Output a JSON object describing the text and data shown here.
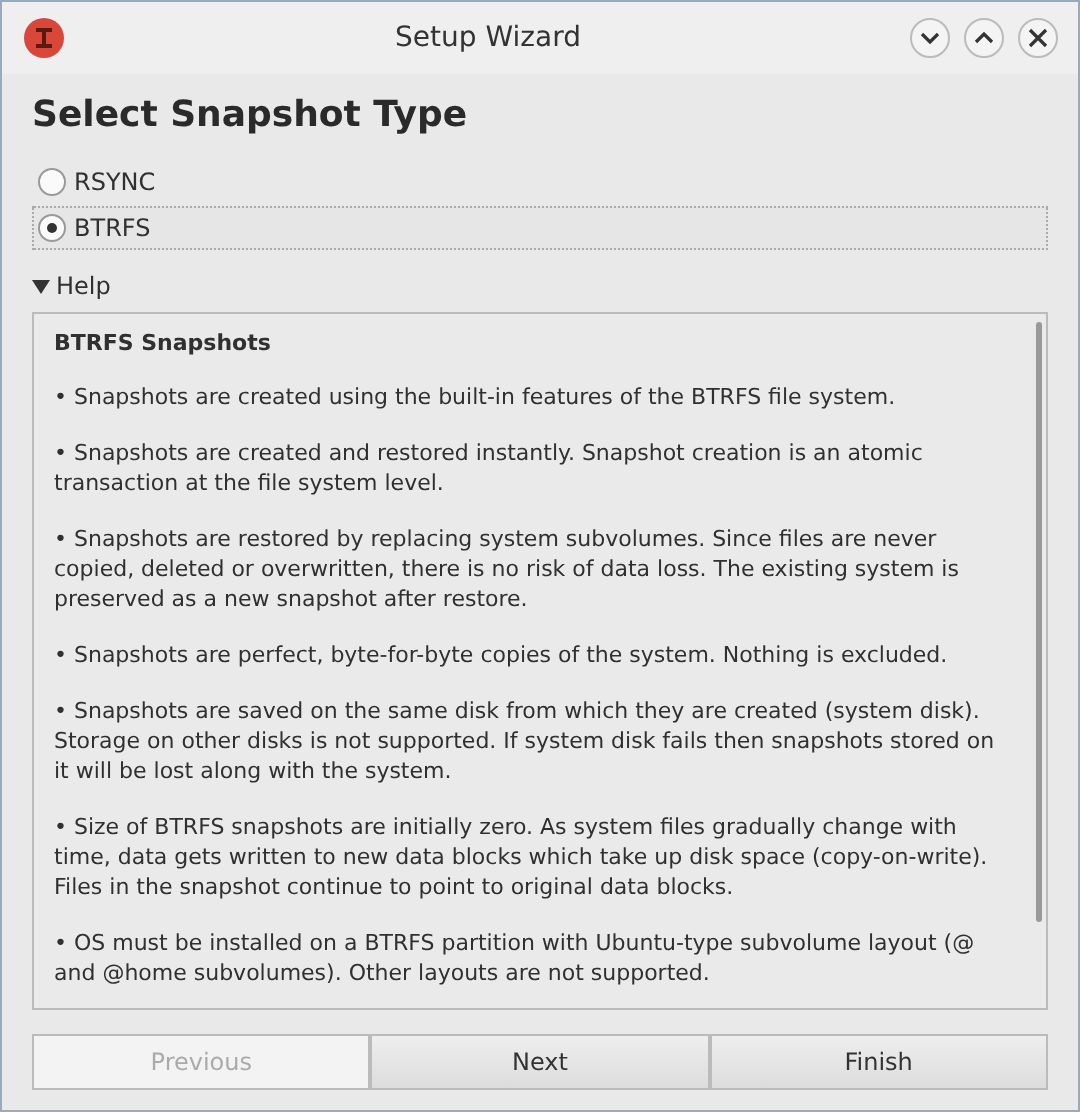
{
  "window": {
    "title": "Setup Wizard"
  },
  "heading": "Select Snapshot Type",
  "options": [
    {
      "label": "RSYNC",
      "selected": false
    },
    {
      "label": "BTRFS",
      "selected": true
    }
  ],
  "help": {
    "label": "Help",
    "expanded": true,
    "title": "BTRFS Snapshots",
    "paragraphs": [
      "• Snapshots are created using the built-in features of the BTRFS file system.",
      "• Snapshots are created and restored instantly. Snapshot creation is an atomic transaction at the file system level.",
      "• Snapshots are restored by replacing system subvolumes. Since files are never copied, deleted or overwritten, there is no risk of data loss. The existing system is preserved as a new snapshot after restore.",
      "• Snapshots are perfect, byte-for-byte copies of the system. Nothing is excluded.",
      "• Snapshots are saved on the same disk from which they are created (system disk). Storage on other disks is not supported. If system disk fails then snapshots stored on it will be lost along with the system.",
      "• Size of BTRFS snapshots are initially zero. As system files gradually change with time, data gets written to new data blocks which take up disk space (copy-on-write). Files in the snapshot continue to point to original data blocks.",
      "• OS must be installed on a BTRFS partition with Ubuntu-type subvolume layout (@ and @home subvolumes). Other layouts are not supported."
    ]
  },
  "buttons": [
    {
      "label": "Previous",
      "disabled": true
    },
    {
      "label": "Next",
      "disabled": false
    },
    {
      "label": "Finish",
      "disabled": false
    }
  ]
}
